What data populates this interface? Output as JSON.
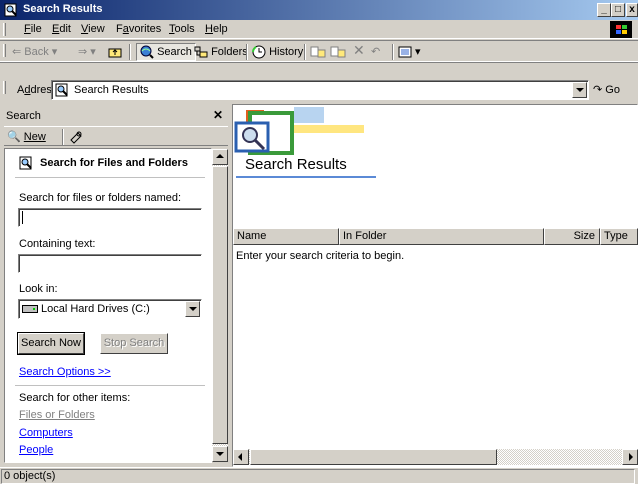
{
  "window": {
    "title": "Search Results"
  },
  "menubar": {
    "items": [
      {
        "label": "File",
        "key": "F",
        "rest": "ile"
      },
      {
        "label": "Edit",
        "key": "E",
        "rest": "dit"
      },
      {
        "label": "View",
        "key": "V",
        "rest": "iew"
      },
      {
        "label": "Favorites",
        "key": "a",
        "pre": "F",
        "rest": "vorites"
      },
      {
        "label": "Tools",
        "key": "T",
        "rest": "ools"
      },
      {
        "label": "Help",
        "key": "H",
        "rest": "elp"
      }
    ]
  },
  "toolbar": {
    "back": "Back",
    "search": "Search",
    "folders": "Folders",
    "history": "History"
  },
  "address": {
    "label": "Address",
    "value": "Search Results",
    "go": "Go"
  },
  "search_pane": {
    "title": "Search",
    "new_label": "New",
    "heading": "Search for Files and Folders",
    "named_label": "Search for files or folders named:",
    "named_value": "",
    "containing_label": "Containing text:",
    "containing_value": "",
    "lookin_label": "Look in:",
    "lookin_value": "Local Hard Drives (C:)",
    "search_now": "Search Now",
    "stop_search": "Stop Search",
    "search_options": "Search Options >>",
    "other_items_label": "Search for other items:",
    "other_items": [
      "Files or Folders",
      "Computers",
      "People"
    ]
  },
  "results": {
    "title": "Search Results",
    "columns": [
      "Name",
      "In Folder",
      "Size",
      "Type"
    ],
    "empty_message": "Enter your search criteria to begin."
  },
  "status": {
    "text": "0 object(s)"
  },
  "colors": {
    "title_start": "#0a246a",
    "title_end": "#a6caf0",
    "link": "#0000ff",
    "face": "#d4d0c8"
  }
}
